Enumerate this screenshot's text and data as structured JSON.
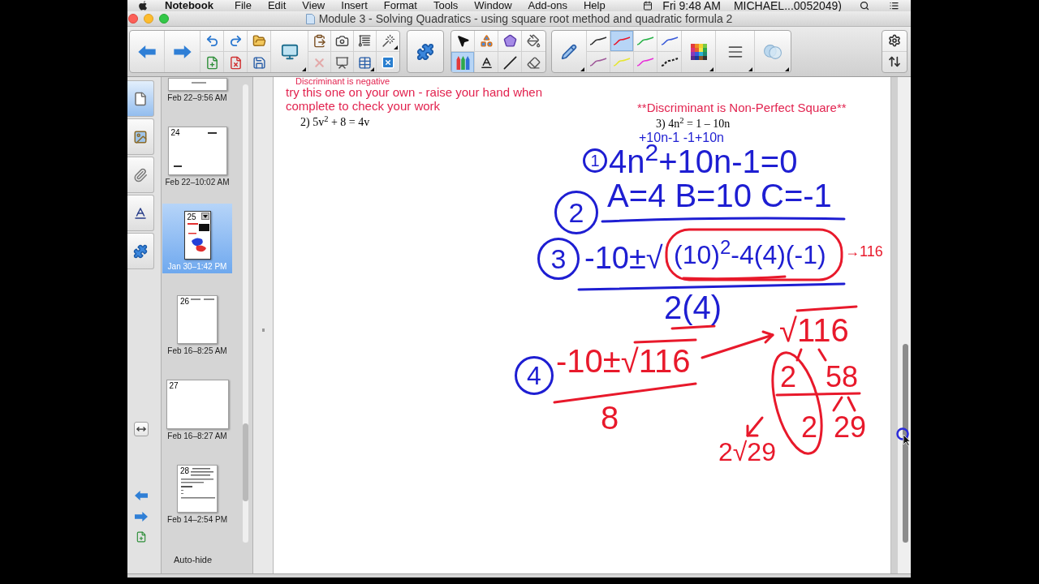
{
  "menu_bar": {
    "app": "Notebook",
    "menus": [
      "File",
      "Edit",
      "View",
      "Insert",
      "Format",
      "Tools",
      "Window",
      "Add-ons",
      "Help"
    ],
    "clock": "Fri 9:48 AM",
    "user": "MICHAEL...0052049)"
  },
  "window": {
    "title": "Module 3 - Solving Quadratics - using square root method and quadratic formula 2"
  },
  "toolbar": {
    "delete_button": {
      "disabled": true
    },
    "tools": [
      {
        "kind": "select",
        "selected": false
      },
      {
        "kind": "shapes",
        "selected": false
      },
      {
        "kind": "polygon",
        "selected": false
      },
      {
        "kind": "fill",
        "selected": false
      },
      {
        "kind": "pens",
        "selected": true
      },
      {
        "kind": "text",
        "selected": false
      },
      {
        "kind": "line",
        "selected": false
      },
      {
        "kind": "eraser",
        "selected": false
      }
    ],
    "line_styles": [
      {
        "kind": "solid",
        "color": "#333333",
        "selected": false
      },
      {
        "kind": "solid",
        "color": "#e8192c",
        "selected": true
      },
      {
        "kind": "solid",
        "color": "#2bb34a",
        "selected": false
      },
      {
        "kind": "solid",
        "color": "#3a5bd9",
        "selected": false
      },
      {
        "kind": "solid",
        "color": "#a05a9a",
        "selected": false
      },
      {
        "kind": "solid",
        "color": "#e6e632",
        "selected": false
      },
      {
        "kind": "solid",
        "color": "#e832d8",
        "selected": false
      },
      {
        "kind": "dashed",
        "color": "#222222",
        "selected": false
      }
    ]
  },
  "side_tabs": [
    {
      "kind": "pages",
      "selected": true
    },
    {
      "kind": "gallery",
      "selected": false
    },
    {
      "kind": "attachments",
      "selected": false
    },
    {
      "kind": "properties",
      "selected": false
    },
    {
      "kind": "addons",
      "selected": false
    }
  ],
  "page_sorter": {
    "pages": [
      {
        "date": "Feb 22–9:56 AM",
        "selected": false
      },
      {
        "number": "24",
        "date": "Feb 22–10:02 AM",
        "selected": false
      },
      {
        "number": "25",
        "date": "Jan 30–1:42 PM",
        "selected": true
      },
      {
        "number": "26",
        "date": "Feb 16–8:25 AM",
        "selected": false
      },
      {
        "number": "27",
        "date": "Feb 16–8:27 AM",
        "selected": false
      },
      {
        "number": "28",
        "date": "Feb 14–2:54 PM",
        "selected": false
      }
    ],
    "auto_hide_label": "Auto-hide"
  },
  "canvas": {
    "texts": [
      {
        "kind": "instruction",
        "text": "Discriminant is negative"
      },
      {
        "kind": "instruction",
        "text": "try this one on your own - raise your hand when complete to check your work"
      },
      {
        "kind": "problem",
        "text": "2) 5v$^{2}$ + 8 = 4v"
      },
      {
        "kind": "instruction",
        "text": "**Discriminant is Non-Perfect Square**"
      },
      {
        "kind": "problem",
        "text": "3) 4n$^{2}$ = 1 – 10n"
      }
    ],
    "ink": [
      {
        "kind": "text",
        "text": "+10n-1 -1+10n",
        "color": "#1e1ed2"
      },
      {
        "kind": "step_number",
        "text": "1",
        "color": "#1e1ed2"
      },
      {
        "kind": "text",
        "text": "4n$^{2}$+10n-1=0",
        "color": "#1e1ed2"
      },
      {
        "kind": "step_number",
        "text": "2",
        "color": "#1e1ed2"
      },
      {
        "kind": "text",
        "text": "A=4 B=10 C=-1",
        "color": "#1e1ed2"
      },
      {
        "kind": "step_number",
        "text": "3",
        "color": "#1e1ed2"
      },
      {
        "kind": "text",
        "text": "-10±√",
        "color": "#1e1ed2"
      },
      {
        "kind": "text",
        "text": "(10)$^{2}$-4(4)(-1)",
        "color": "#1e1ed2"
      },
      {
        "kind": "text",
        "text": "→116",
        "color": "#e8192b"
      },
      {
        "kind": "text",
        "text": "2(4)",
        "color": "#1e1ed2"
      },
      {
        "kind": "step_number",
        "text": "4",
        "color": "#1e1ed2"
      },
      {
        "kind": "text",
        "text": "-10±√116",
        "color": "#e8192b"
      },
      {
        "kind": "text",
        "text": "8",
        "color": "#e8192b"
      },
      {
        "kind": "text",
        "text": "√116",
        "color": "#e8192b"
      },
      {
        "kind": "text",
        "text": "2",
        "color": "#e8192b"
      },
      {
        "kind": "text",
        "text": "58",
        "color": "#e8192b"
      },
      {
        "kind": "text",
        "text": "2",
        "color": "#e8192b"
      },
      {
        "kind": "text",
        "text": "29",
        "color": "#e8192b"
      },
      {
        "kind": "text",
        "text": "2√29",
        "color": "#e8192b"
      }
    ]
  }
}
